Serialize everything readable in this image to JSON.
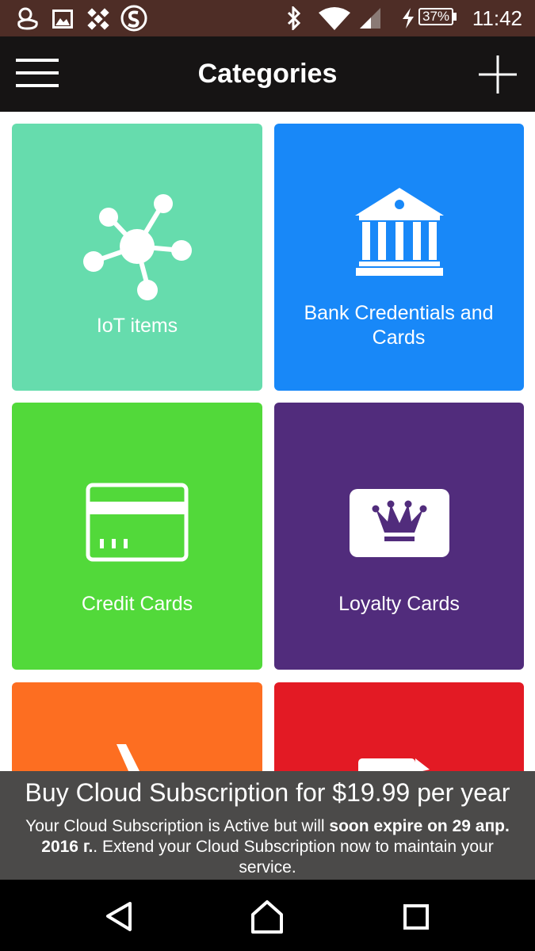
{
  "status_bar": {
    "time": "11:42",
    "battery": "37%",
    "icons": [
      "chat-head-icon",
      "image-icon",
      "app-icon",
      "s-icon",
      "bluetooth-icon",
      "wifi-icon",
      "signal-icon",
      "charging-icon"
    ]
  },
  "app_bar": {
    "title": "Categories",
    "menu_icon": "hamburger-menu-icon",
    "add_icon": "plus-icon"
  },
  "categories": [
    {
      "label": "IoT items",
      "color": "#66dcad",
      "icon": "network-icon"
    },
    {
      "label": "Bank Credentials and Cards",
      "color": "#1888f8",
      "icon": "bank-icon"
    },
    {
      "label": "Credit Cards",
      "color": "#52d93a",
      "icon": "credit-card-icon"
    },
    {
      "label": "Loyalty Cards",
      "color": "#512c7c",
      "icon": "crown-card-icon"
    },
    {
      "label": "",
      "color": "#fd6e21",
      "icon": "partial-icon"
    },
    {
      "label": "",
      "color": "#e31a24",
      "icon": "partial-icon"
    }
  ],
  "promo": {
    "title": "Buy Cloud Subscription for $19.99 per year",
    "body_pre": "Your Cloud Subscription is Active but will ",
    "body_bold": "soon expire on 29 апр. 2016 г.",
    "body_post": ". Extend your Cloud Subscription now to maintain your service."
  },
  "nav_bar": {
    "back_icon": "back-triangle-icon",
    "home_icon": "home-icon",
    "recents_icon": "recents-square-icon"
  }
}
